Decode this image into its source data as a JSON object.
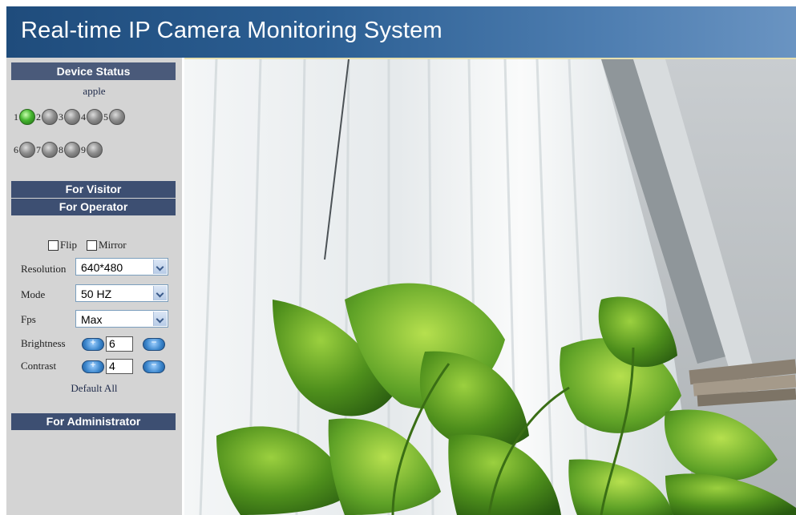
{
  "header": {
    "title": "Real-time IP Camera Monitoring System"
  },
  "sidebar": {
    "device_status_label": "Device Status",
    "device_name": "apple",
    "cameras": [
      {
        "num": "1",
        "active": true
      },
      {
        "num": "2",
        "active": false
      },
      {
        "num": "3",
        "active": false
      },
      {
        "num": "4",
        "active": false
      },
      {
        "num": "5",
        "active": false
      },
      {
        "num": "6",
        "active": false
      },
      {
        "num": "7",
        "active": false
      },
      {
        "num": "8",
        "active": false
      },
      {
        "num": "9",
        "active": false
      }
    ],
    "visitor_label": "For Visitor",
    "operator_label": "For Operator",
    "admin_label": "For Administrator"
  },
  "operator": {
    "flip_label": "Flip",
    "mirror_label": "Mirror",
    "resolution_label": "Resolution",
    "resolution_value": "640*480",
    "mode_label": "Mode",
    "mode_value": "50 HZ",
    "fps_label": "Fps",
    "fps_value": "Max",
    "brightness_label": "Brightness",
    "brightness_value": "6",
    "contrast_label": "Contrast",
    "contrast_value": "4",
    "default_all_label": "Default All"
  },
  "colors": {
    "header_dark": "#1f4c7c",
    "section_bar": "#3d4f72",
    "sidebar_bg": "#d4d4d4",
    "active_light": "#45b52f"
  }
}
